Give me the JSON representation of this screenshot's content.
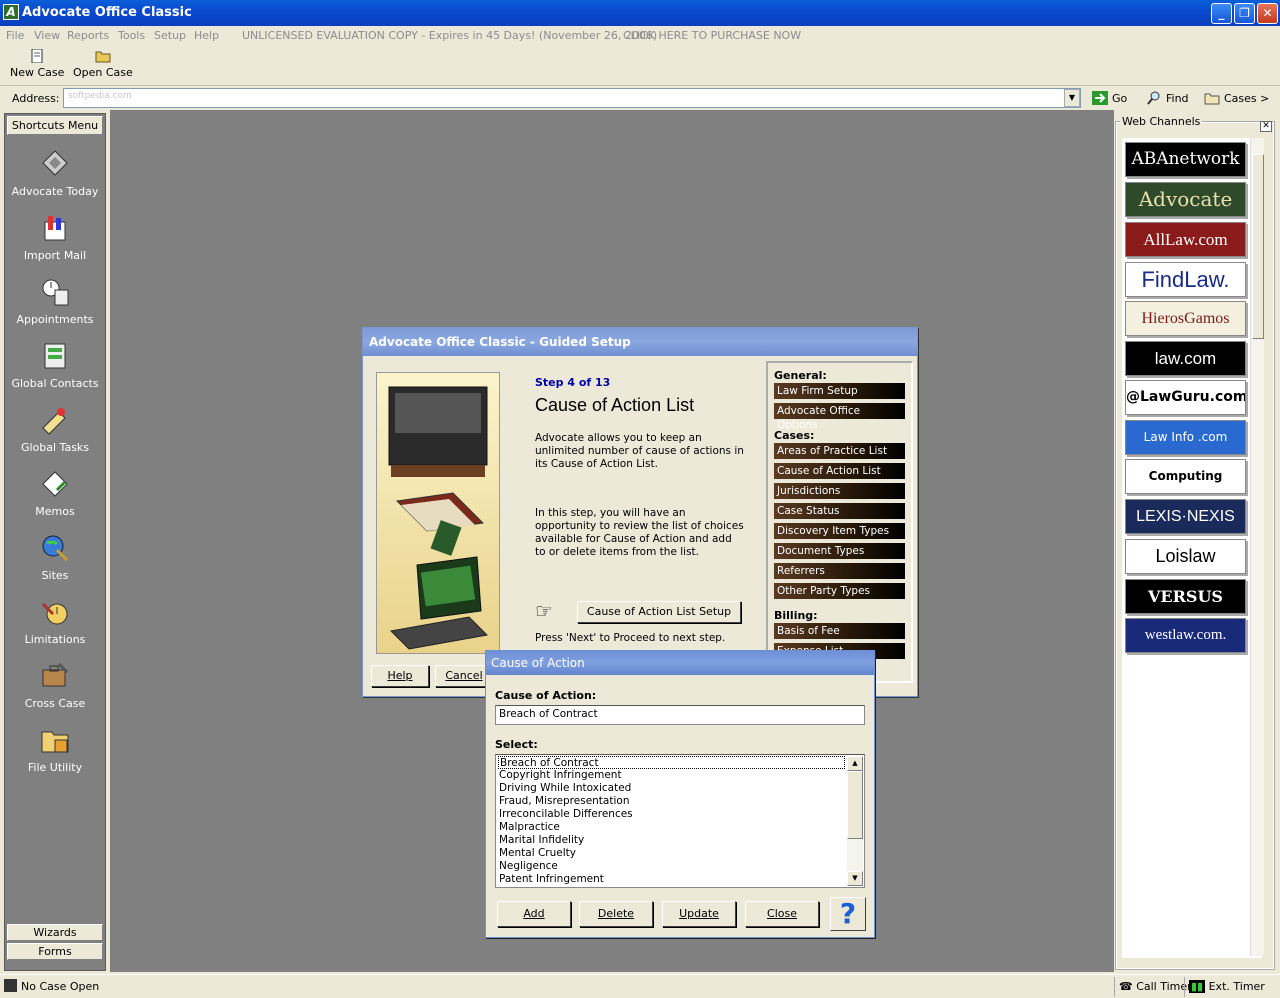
{
  "window": {
    "title": "Advocate Office Classic",
    "app_icon": "A"
  },
  "menu": {
    "items": [
      "File",
      "View",
      "Reports",
      "Tools",
      "Setup",
      "Help"
    ],
    "eval_notice": "UNLICENSED EVALUATION COPY - Expires in 45 Days!  (November 26, 2006)",
    "purchase_link": "CLICK HERE TO PURCHASE NOW"
  },
  "toolbar": {
    "new_case": "New Case",
    "open_case": "Open Case"
  },
  "address": {
    "label": "Address:",
    "value": "softpedia.com",
    "go": "Go",
    "find": "Find",
    "cases": "Cases >"
  },
  "sidebar": {
    "header": "Shortcuts Menu",
    "items": [
      {
        "label": "Advocate Today",
        "icon": "advocate-today-icon"
      },
      {
        "label": "Import Mail",
        "icon": "import-mail-icon"
      },
      {
        "label": "Appointments",
        "icon": "appointments-icon"
      },
      {
        "label": "Global Contacts",
        "icon": "global-contacts-icon"
      },
      {
        "label": "Global Tasks",
        "icon": "global-tasks-icon"
      },
      {
        "label": "Memos",
        "icon": "memos-icon"
      },
      {
        "label": "Sites",
        "icon": "sites-icon"
      },
      {
        "label": "Limitations",
        "icon": "limitations-icon"
      },
      {
        "label": "Cross Case",
        "icon": "cross-case-icon"
      },
      {
        "label": "File Utility",
        "icon": "file-utility-icon"
      }
    ],
    "wizards": "Wizards",
    "forms": "Forms"
  },
  "web_channels": {
    "title": "Web Channels",
    "logos": [
      {
        "text": "ABAnetwork",
        "bg": "#000000",
        "fg": "#ffffff"
      },
      {
        "text": "Advocate",
        "bg": "#2f4a2a",
        "fg": "#e8e0b0"
      },
      {
        "text": "AllLaw.com",
        "bg": "#8b1a1a",
        "fg": "#ffffff"
      },
      {
        "text": "FindLaw.",
        "bg": "#ffffff",
        "fg": "#1a2a8a"
      },
      {
        "text": "HierosGamos",
        "bg": "#f4f0e0",
        "fg": "#7a1a1a"
      },
      {
        "text": "law.com",
        "bg": "#000000",
        "fg": "#ffffff"
      },
      {
        "text": "@LawGuru.com",
        "bg": "#ffffff",
        "fg": "#000000"
      },
      {
        "text": "Law Info .com",
        "bg": "#2a6ad0",
        "fg": "#ffffff"
      },
      {
        "text": "Computing online",
        "bg": "#ffffff",
        "fg": "#000000"
      },
      {
        "text": "LEXIS·NEXIS",
        "bg": "#1a2a5a",
        "fg": "#ffffff"
      },
      {
        "text": "Loislaw",
        "bg": "#ffffff",
        "fg": "#000000"
      },
      {
        "text": "VERSUS LAW",
        "bg": "#000000",
        "fg": "#ffffff"
      },
      {
        "text": "westlaw.com.",
        "bg": "#1a2a7a",
        "fg": "#ffffff"
      }
    ]
  },
  "status": {
    "case": "No Case Open",
    "call_timer": "Call Timer",
    "ext_timer": "Ext. Timer"
  },
  "setup": {
    "title": "Advocate Office Classic - Guided Setup",
    "step": "Step 4 of 13",
    "heading": "Cause of Action List",
    "p1": "Advocate allows you to keep an unlimited number of cause of actions in its Cause of Action List.",
    "p2": "In this step,  you will have an opportunity to review the list of choices available for Cause of Action and add to or delete items from the list.",
    "setup_button": "Cause of Action List Setup",
    "next_hint": "Press 'Next' to Proceed to next step.",
    "help": "Help",
    "cancel": "Cancel",
    "general_label": "General:",
    "general": [
      "Law Firm Setup",
      "Advocate Office Options"
    ],
    "cases_label": "Cases:",
    "cases": [
      "Areas of Practice List",
      "Cause of Action List",
      "Jurisdictions",
      "Case Status",
      "Discovery Item Types",
      "Document Types",
      "Referrers",
      "Other Party Types"
    ],
    "billing_label": "Billing:",
    "billing": [
      "Basis of Fee",
      "Expense List"
    ]
  },
  "coa": {
    "title": "Cause of Action",
    "field_label": "Cause of Action:",
    "value": "Breach of Contract",
    "select_label": "Select:",
    "options": [
      "Breach of Contract",
      "Copyright Infringement",
      "Driving While Intoxicated",
      "Fraud, Misrepresentation",
      "Irreconcilable Differences",
      "Malpractice",
      "Marital Infidelity",
      "Mental Cruelty",
      "Negligence",
      "Patent Infringement"
    ],
    "add": "Add",
    "delete": "Delete",
    "update": "Update",
    "close": "Close",
    "help": "?"
  }
}
